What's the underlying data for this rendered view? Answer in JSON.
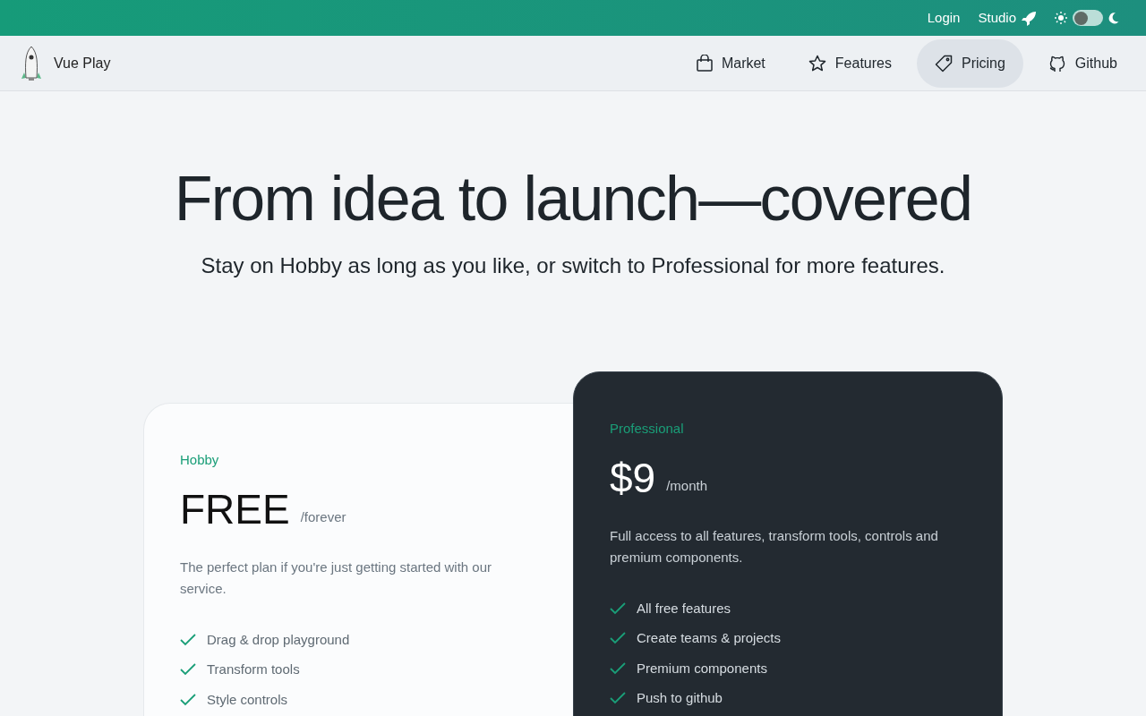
{
  "top_bar": {
    "links": [
      {
        "label": "Login",
        "kind": "text"
      },
      {
        "label": "Studio",
        "kind": "rocket"
      }
    ],
    "dark_mode": false
  },
  "brand": {
    "name": "Vue Play"
  },
  "nav": [
    {
      "label": "Market",
      "kind": "bag",
      "selected": false
    },
    {
      "label": "Features",
      "kind": "star",
      "selected": false
    },
    {
      "label": "Pricing",
      "kind": "tag",
      "selected": true
    },
    {
      "label": "Github",
      "kind": "github",
      "selected": false
    }
  ],
  "hero": {
    "title": "From idea to launch—covered",
    "subtitle": "Stay on Hobby as long as you like, or switch to Professional for more features."
  },
  "plans": [
    {
      "name": "Hobby",
      "featured": false,
      "price": "FREE",
      "period": "/forever",
      "description": "The perfect plan if you're just getting started with our service.",
      "features": [
        "Drag & drop playground",
        "Transform tools",
        "Style controls"
      ]
    },
    {
      "name": "Professional",
      "featured": true,
      "price": "$9",
      "period": "/month",
      "description": "Full access to all features, transform tools, controls and premium components.",
      "features": [
        "All free features",
        "Create teams & projects",
        "Premium components",
        "Push to github"
      ]
    }
  ]
}
